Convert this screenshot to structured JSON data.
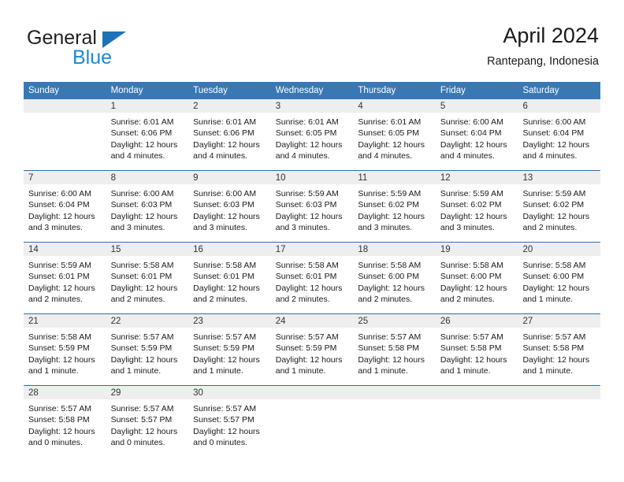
{
  "brand": {
    "name_top": "General",
    "name_bottom": "Blue",
    "triangle_color": "#1c71b8",
    "blue_text_color": "#1c87d8"
  },
  "header": {
    "title": "April 2024",
    "subtitle": "Rantepang, Indonesia"
  },
  "theme": {
    "header_blue": "#3878b4",
    "row_divider_blue": "#2f6fad",
    "day_band_gray": "#eeeeee"
  },
  "calendar": {
    "weekday_headers": [
      "Sunday",
      "Monday",
      "Tuesday",
      "Wednesday",
      "Thursday",
      "Friday",
      "Saturday"
    ],
    "weeks": [
      [
        {
          "day": "",
          "lines": []
        },
        {
          "day": "1",
          "lines": [
            "Sunrise: 6:01 AM",
            "Sunset: 6:06 PM",
            "Daylight: 12 hours",
            "and 4 minutes."
          ]
        },
        {
          "day": "2",
          "lines": [
            "Sunrise: 6:01 AM",
            "Sunset: 6:06 PM",
            "Daylight: 12 hours",
            "and 4 minutes."
          ]
        },
        {
          "day": "3",
          "lines": [
            "Sunrise: 6:01 AM",
            "Sunset: 6:05 PM",
            "Daylight: 12 hours",
            "and 4 minutes."
          ]
        },
        {
          "day": "4",
          "lines": [
            "Sunrise: 6:01 AM",
            "Sunset: 6:05 PM",
            "Daylight: 12 hours",
            "and 4 minutes."
          ]
        },
        {
          "day": "5",
          "lines": [
            "Sunrise: 6:00 AM",
            "Sunset: 6:04 PM",
            "Daylight: 12 hours",
            "and 4 minutes."
          ]
        },
        {
          "day": "6",
          "lines": [
            "Sunrise: 6:00 AM",
            "Sunset: 6:04 PM",
            "Daylight: 12 hours",
            "and 4 minutes."
          ]
        }
      ],
      [
        {
          "day": "7",
          "lines": [
            "Sunrise: 6:00 AM",
            "Sunset: 6:04 PM",
            "Daylight: 12 hours",
            "and 3 minutes."
          ]
        },
        {
          "day": "8",
          "lines": [
            "Sunrise: 6:00 AM",
            "Sunset: 6:03 PM",
            "Daylight: 12 hours",
            "and 3 minutes."
          ]
        },
        {
          "day": "9",
          "lines": [
            "Sunrise: 6:00 AM",
            "Sunset: 6:03 PM",
            "Daylight: 12 hours",
            "and 3 minutes."
          ]
        },
        {
          "day": "10",
          "lines": [
            "Sunrise: 5:59 AM",
            "Sunset: 6:03 PM",
            "Daylight: 12 hours",
            "and 3 minutes."
          ]
        },
        {
          "day": "11",
          "lines": [
            "Sunrise: 5:59 AM",
            "Sunset: 6:02 PM",
            "Daylight: 12 hours",
            "and 3 minutes."
          ]
        },
        {
          "day": "12",
          "lines": [
            "Sunrise: 5:59 AM",
            "Sunset: 6:02 PM",
            "Daylight: 12 hours",
            "and 3 minutes."
          ]
        },
        {
          "day": "13",
          "lines": [
            "Sunrise: 5:59 AM",
            "Sunset: 6:02 PM",
            "Daylight: 12 hours",
            "and 2 minutes."
          ]
        }
      ],
      [
        {
          "day": "14",
          "lines": [
            "Sunrise: 5:59 AM",
            "Sunset: 6:01 PM",
            "Daylight: 12 hours",
            "and 2 minutes."
          ]
        },
        {
          "day": "15",
          "lines": [
            "Sunrise: 5:58 AM",
            "Sunset: 6:01 PM",
            "Daylight: 12 hours",
            "and 2 minutes."
          ]
        },
        {
          "day": "16",
          "lines": [
            "Sunrise: 5:58 AM",
            "Sunset: 6:01 PM",
            "Daylight: 12 hours",
            "and 2 minutes."
          ]
        },
        {
          "day": "17",
          "lines": [
            "Sunrise: 5:58 AM",
            "Sunset: 6:01 PM",
            "Daylight: 12 hours",
            "and 2 minutes."
          ]
        },
        {
          "day": "18",
          "lines": [
            "Sunrise: 5:58 AM",
            "Sunset: 6:00 PM",
            "Daylight: 12 hours",
            "and 2 minutes."
          ]
        },
        {
          "day": "19",
          "lines": [
            "Sunrise: 5:58 AM",
            "Sunset: 6:00 PM",
            "Daylight: 12 hours",
            "and 2 minutes."
          ]
        },
        {
          "day": "20",
          "lines": [
            "Sunrise: 5:58 AM",
            "Sunset: 6:00 PM",
            "Daylight: 12 hours",
            "and 1 minute."
          ]
        }
      ],
      [
        {
          "day": "21",
          "lines": [
            "Sunrise: 5:58 AM",
            "Sunset: 5:59 PM",
            "Daylight: 12 hours",
            "and 1 minute."
          ]
        },
        {
          "day": "22",
          "lines": [
            "Sunrise: 5:57 AM",
            "Sunset: 5:59 PM",
            "Daylight: 12 hours",
            "and 1 minute."
          ]
        },
        {
          "day": "23",
          "lines": [
            "Sunrise: 5:57 AM",
            "Sunset: 5:59 PM",
            "Daylight: 12 hours",
            "and 1 minute."
          ]
        },
        {
          "day": "24",
          "lines": [
            "Sunrise: 5:57 AM",
            "Sunset: 5:59 PM",
            "Daylight: 12 hours",
            "and 1 minute."
          ]
        },
        {
          "day": "25",
          "lines": [
            "Sunrise: 5:57 AM",
            "Sunset: 5:58 PM",
            "Daylight: 12 hours",
            "and 1 minute."
          ]
        },
        {
          "day": "26",
          "lines": [
            "Sunrise: 5:57 AM",
            "Sunset: 5:58 PM",
            "Daylight: 12 hours",
            "and 1 minute."
          ]
        },
        {
          "day": "27",
          "lines": [
            "Sunrise: 5:57 AM",
            "Sunset: 5:58 PM",
            "Daylight: 12 hours",
            "and 1 minute."
          ]
        }
      ],
      [
        {
          "day": "28",
          "lines": [
            "Sunrise: 5:57 AM",
            "Sunset: 5:58 PM",
            "Daylight: 12 hours",
            "and 0 minutes."
          ]
        },
        {
          "day": "29",
          "lines": [
            "Sunrise: 5:57 AM",
            "Sunset: 5:57 PM",
            "Daylight: 12 hours",
            "and 0 minutes."
          ]
        },
        {
          "day": "30",
          "lines": [
            "Sunrise: 5:57 AM",
            "Sunset: 5:57 PM",
            "Daylight: 12 hours",
            "and 0 minutes."
          ]
        },
        {
          "day": "",
          "lines": []
        },
        {
          "day": "",
          "lines": []
        },
        {
          "day": "",
          "lines": []
        },
        {
          "day": "",
          "lines": []
        }
      ]
    ]
  }
}
